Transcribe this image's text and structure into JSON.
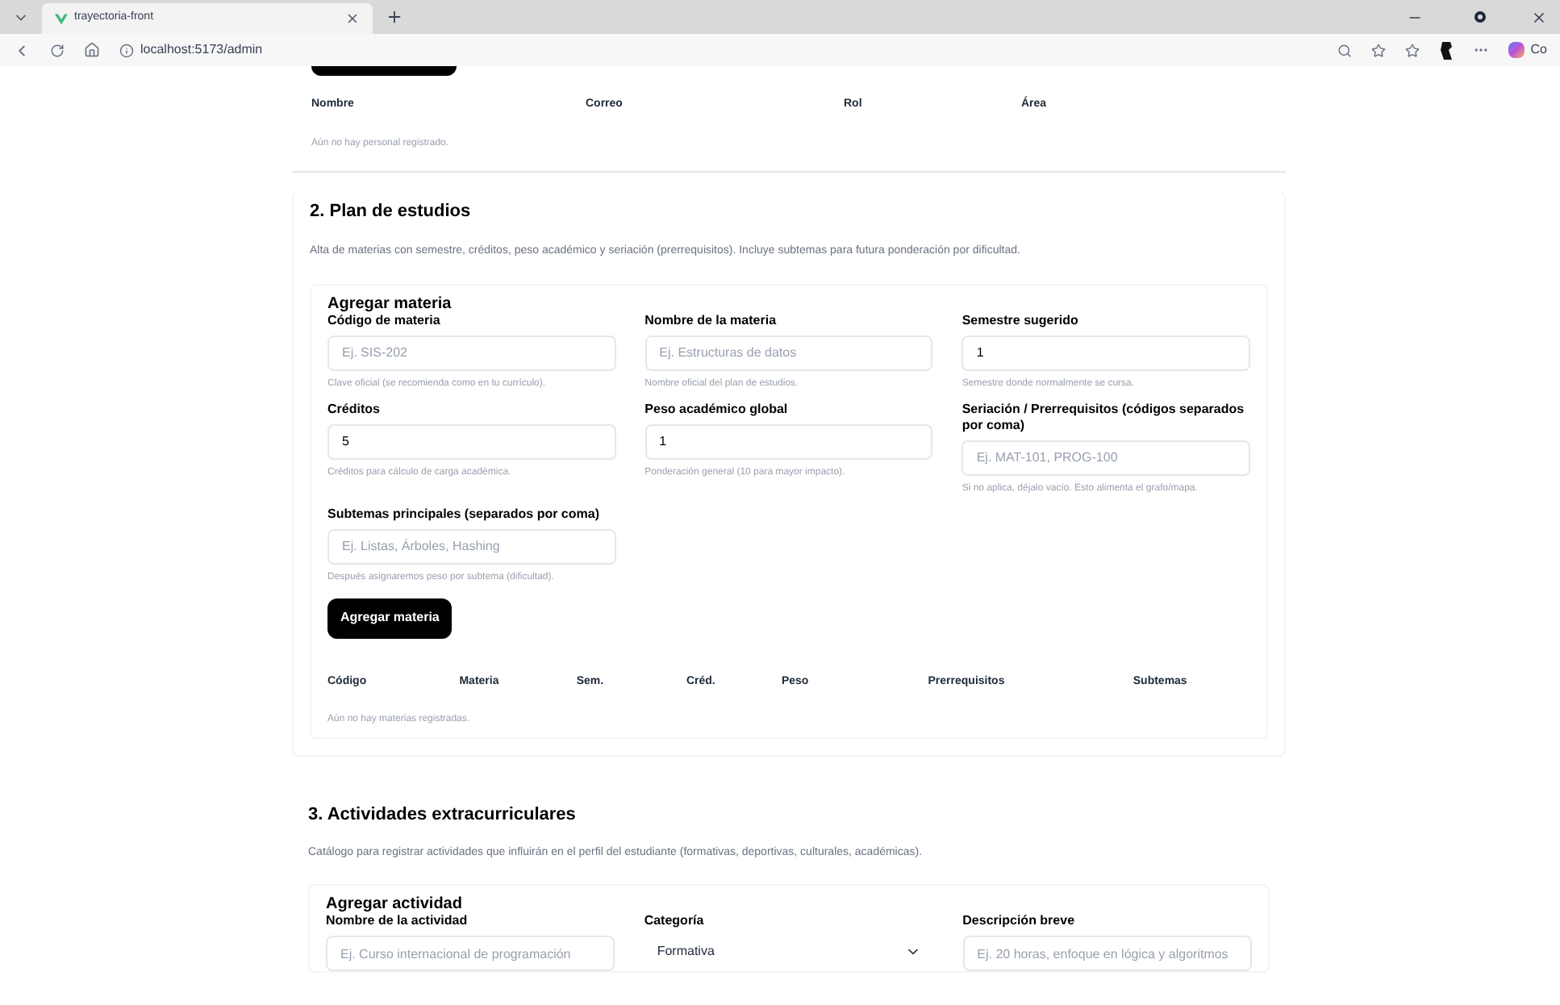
{
  "browser": {
    "tab_title": "trayectoria-front",
    "url": "localhost:5173/admin",
    "profile_label": "Co"
  },
  "staff": {
    "columns": [
      "Nombre",
      "Correo",
      "Rol",
      "Área"
    ],
    "empty": "Aún no hay personal registrado."
  },
  "plan": {
    "title": "2. Plan de estudios",
    "description": "Alta de materias con semestre, créditos, peso académico y seriación (prerrequisitos). Incluye subtemas para futura ponderación por dificultad.",
    "form_title": "Agregar materia",
    "fields": [
      {
        "label": "Código de materia",
        "placeholder": "Ej. SIS-202",
        "helper": "Clave oficial (se recomienda como en tu currículo)."
      },
      {
        "label": "Nombre de la materia",
        "placeholder": "Ej. Estructuras de datos",
        "helper": "Nombre oficial del plan de estudios."
      },
      {
        "label": "Semestre sugerido",
        "value": "1",
        "helper": "Semestre donde normalmente se cursa."
      },
      {
        "label": "Créditos",
        "value": "5",
        "helper": "Créditos para cálculo de carga académica."
      },
      {
        "label": "Peso académico global",
        "value": "1",
        "helper": "Ponderación general (10 para mayor impacto)."
      },
      {
        "label": "Seriación / Prerrequisitos (códigos separados por coma)",
        "placeholder": "Ej. MAT-101, PROG-100",
        "helper": "Si no aplica, déjalo vacío. Esto alimenta el grafo/mapa."
      },
      {
        "label": "Subtemas principales (separados por coma)",
        "placeholder": "Ej. Listas, Árboles, Hashing",
        "helper": "Después asignaremos peso por subtema (dificultad)."
      }
    ],
    "button": "Agregar materia",
    "columns": [
      "Código",
      "Materia",
      "Sem.",
      "Créd.",
      "Peso",
      "Prerrequisitos",
      "Subtemas"
    ],
    "empty": "Aún no hay materias registradas."
  },
  "activities": {
    "title": "3. Actividades extracurriculares",
    "description": "Catálogo para registrar actividades que influirán en el perfil del estudiante (formativas, deportivas, culturales, académicas).",
    "form_title": "Agregar actividad",
    "fields": [
      {
        "kind": "input",
        "label": "Nombre de la actividad",
        "placeholder": "Ej. Curso internacional de programación"
      },
      {
        "kind": "select",
        "label": "Categoría",
        "value": "Formativa"
      },
      {
        "kind": "input",
        "label": "Descripción breve",
        "placeholder": "Ej. 20 horas, enfoque en lógica y algoritmos"
      }
    ]
  }
}
